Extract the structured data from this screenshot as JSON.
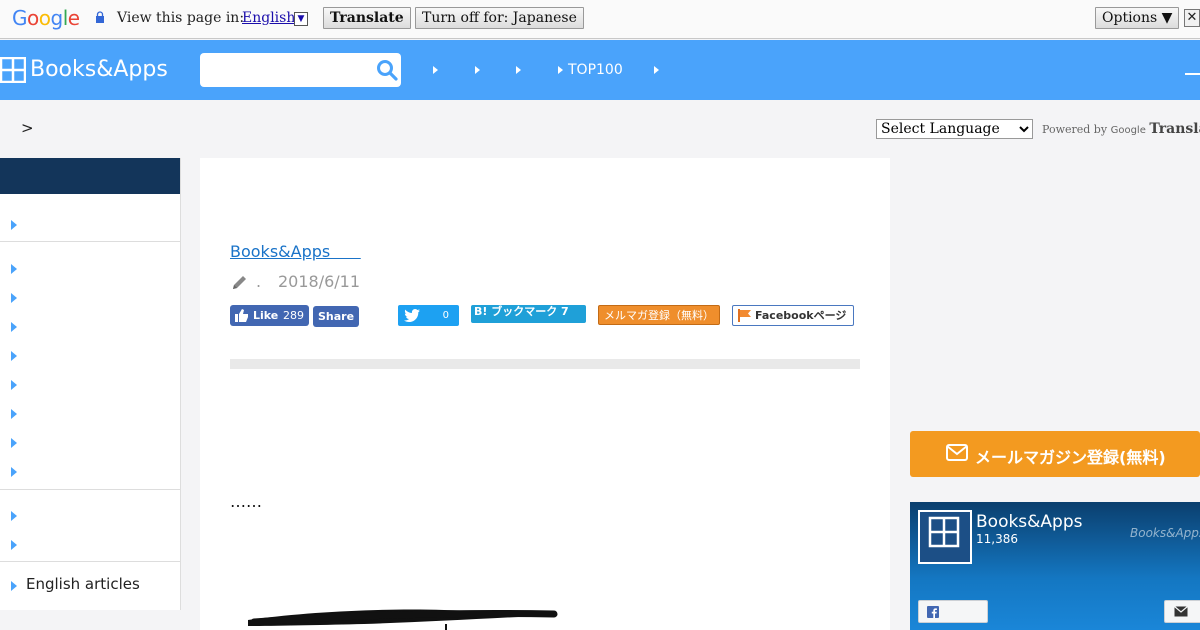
{
  "google_bar": {
    "logo": "Google",
    "view_text": "View this page in:",
    "language": "English",
    "translate_label": "Translate",
    "turn_off_label": "Turn off for: Japanese",
    "options_label": "Options ▼",
    "close": "✕"
  },
  "header": {
    "logo_text": "Books&Apps",
    "search_placeholder": "",
    "nav_items": [
      "",
      "",
      "",
      "TOP100",
      ""
    ]
  },
  "breadcrumb": ">",
  "translate_widget": {
    "select_label": "Select Language",
    "powered_by": "Powered by",
    "google": "Google",
    "translate": "Translate"
  },
  "sidebar": {
    "items": [
      "",
      "",
      "",
      "",
      "",
      "",
      "",
      "",
      "",
      "",
      "",
      "English articles"
    ]
  },
  "article": {
    "author_link": "Books&Apps      ",
    "author_dot": ".",
    "date": "2018/6/11",
    "fb_like": "Like",
    "fb_like_count": "289",
    "fb_share": "Share",
    "tweet_count": "0",
    "hatena": "B! ブックマーク 7",
    "mailmag": "メルマガ登録（無料）",
    "fb_page": "Facebookページ",
    "ellipsis": "……"
  },
  "right": {
    "mail_button": "メールマガジン登録(無料)",
    "fb_box": {
      "name": "Books&Apps",
      "followers": "11,386",
      "watermark": "Books&Apps"
    }
  },
  "colors": {
    "header": "#4aa3fb",
    "sidebar_head": "#13355a",
    "mail_button": "#f39a20"
  }
}
